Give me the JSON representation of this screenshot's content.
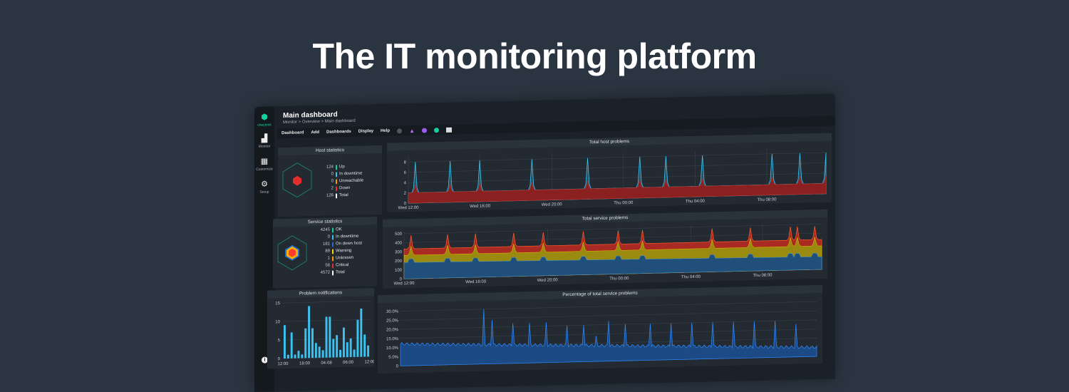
{
  "headline": "The IT monitoring platform",
  "sidebar": {
    "logo": "checkmk",
    "items": [
      {
        "label": "Monitor",
        "icon": "bar-chart-icon"
      },
      {
        "label": "Customize",
        "icon": "grid-icon"
      },
      {
        "label": "Setup",
        "icon": "gear-icon"
      }
    ]
  },
  "header": {
    "title": "Main dashboard",
    "breadcrumb": "Monitor > Overview > Main dashboard"
  },
  "menu": [
    "Dashboard",
    "Add",
    "Dashboards",
    "Display",
    "Help"
  ],
  "colors": {
    "ok": "#15d1a0",
    "downtime": "#3cc2f0",
    "ondown": "#1e6fd0",
    "warning": "#ffd600",
    "unknown": "#ff9800",
    "critical": "#e52d2d",
    "total": "#ffffff"
  },
  "host_stats": {
    "title": "Host statistics",
    "rows": [
      {
        "n": "124",
        "label": "Up",
        "c": "#15d1a0"
      },
      {
        "n": "0",
        "label": "In downtime",
        "c": "#3cc2f0"
      },
      {
        "n": "0",
        "label": "Unreachable",
        "c": "#ff9800"
      },
      {
        "n": "2",
        "label": "Down",
        "c": "#e52d2d"
      },
      {
        "n": "126",
        "label": "Total",
        "c": "#ffffff"
      }
    ]
  },
  "service_stats": {
    "title": "Service statistics",
    "rows": [
      {
        "n": "4245",
        "label": "OK",
        "c": "#15d1a0"
      },
      {
        "n": "0",
        "label": "In downtime",
        "c": "#3cc2f0"
      },
      {
        "n": "181",
        "label": "On down host",
        "c": "#1e6fd0"
      },
      {
        "n": "89",
        "label": "Warning",
        "c": "#ffd600"
      },
      {
        "n": "1",
        "label": "Unknown",
        "c": "#ff9800"
      },
      {
        "n": "56",
        "label": "Critical",
        "c": "#e52d2d"
      },
      {
        "n": "4572",
        "label": "Total",
        "c": "#ffffff"
      }
    ]
  },
  "chart_data": [
    {
      "type": "area",
      "title": "Total host problems",
      "xticks": [
        "Wed 12:00",
        "Wed 16:00",
        "Wed 20:00",
        "Thu 00:00",
        "Thu 04:00",
        "Thu 08:00"
      ],
      "xrange_hours": [
        0,
        24
      ],
      "yticks": [
        0,
        2,
        4,
        6,
        8
      ],
      "ylim": [
        0,
        9
      ],
      "base_down": 2,
      "spikes_hours": [
        0.4,
        2.4,
        4.1,
        7.1,
        10.3,
        13.3,
        14.8,
        16.9,
        20.9,
        22.5,
        24
      ],
      "spike_value": 8
    },
    {
      "type": "area",
      "title": "Total service problems",
      "xticks": [
        "Wed 12:00",
        "Wed 16:00",
        "Wed 20:00",
        "Thu 00:00",
        "Thu 04:00",
        "Thu 08:00"
      ],
      "xrange_hours": [
        0,
        24
      ],
      "yticks": [
        0,
        100,
        200,
        300,
        400,
        500
      ],
      "ylim": [
        0,
        520
      ],
      "layers": {
        "ondown": 180,
        "warning": 270,
        "critical": 330
      },
      "spikes_hours": [
        0.4,
        2.5,
        4.1,
        6.3,
        8.0,
        10.3,
        12.3,
        13.7,
        17.7,
        19.9,
        22.2,
        22.6,
        23.6
      ],
      "spike_value": 480
    },
    {
      "type": "area",
      "title": "Percentage of total service problems",
      "yticks": [
        "0",
        "5.0%",
        "10.0%",
        "15.0%",
        "20.0%",
        "25.0%",
        "30.0%"
      ],
      "ylim": [
        0,
        32
      ],
      "start": 12,
      "end": 5,
      "spikes": [
        [
          0.2,
          30
        ],
        [
          0.22,
          24
        ],
        [
          0.27,
          22
        ],
        [
          0.31,
          22
        ],
        [
          0.35,
          22
        ],
        [
          0.4,
          20
        ],
        [
          0.44,
          20
        ],
        [
          0.47,
          14
        ],
        [
          0.5,
          22
        ],
        [
          0.54,
          20
        ],
        [
          0.6,
          20
        ],
        [
          0.65,
          20
        ],
        [
          0.7,
          20
        ],
        [
          0.75,
          20
        ],
        [
          0.8,
          20
        ],
        [
          0.85,
          20
        ],
        [
          0.9,
          20
        ],
        [
          0.95,
          18
        ]
      ]
    },
    {
      "type": "bar",
      "title": "Problem notifications",
      "xticks": [
        "12:00",
        "18:00",
        "04-08",
        "06:00",
        "12:00"
      ],
      "yticks": [
        0,
        5,
        10,
        15
      ],
      "ylim": [
        0,
        15
      ],
      "values": [
        9,
        1,
        7,
        1,
        2,
        1,
        8,
        14,
        8,
        4,
        3,
        2,
        11,
        11,
        5,
        6,
        2,
        8,
        4,
        5,
        2,
        10,
        13,
        6,
        3
      ]
    }
  ]
}
